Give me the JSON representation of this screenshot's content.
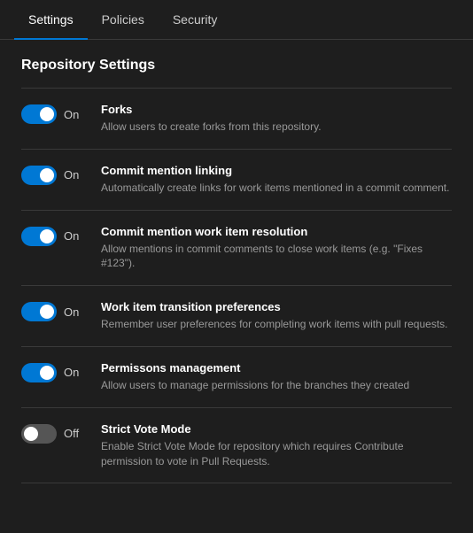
{
  "nav": {
    "tabs": [
      {
        "id": "settings",
        "label": "Settings",
        "active": true
      },
      {
        "id": "policies",
        "label": "Policies",
        "active": false
      },
      {
        "id": "security",
        "label": "Security",
        "active": false
      }
    ]
  },
  "section": {
    "title": "Repository Settings"
  },
  "settings": [
    {
      "id": "forks",
      "on": true,
      "toggle_label_on": "On",
      "toggle_label_off": "Off",
      "title": "Forks",
      "description": "Allow users to create forks from this repository."
    },
    {
      "id": "commit-mention-linking",
      "on": true,
      "toggle_label_on": "On",
      "toggle_label_off": "Off",
      "title": "Commit mention linking",
      "description": "Automatically create links for work items mentioned in a commit comment."
    },
    {
      "id": "commit-mention-work-item",
      "on": true,
      "toggle_label_on": "On",
      "toggle_label_off": "Off",
      "title": "Commit mention work item resolution",
      "description": "Allow mentions in commit comments to close work items (e.g. \"Fixes #123\")."
    },
    {
      "id": "work-item-transition",
      "on": true,
      "toggle_label_on": "On",
      "toggle_label_off": "Off",
      "title": "Work item transition preferences",
      "description": "Remember user preferences for completing work items with pull requests."
    },
    {
      "id": "permissions-management",
      "on": true,
      "toggle_label_on": "On",
      "toggle_label_off": "Off",
      "title": "Permissons management",
      "description": "Allow users to manage permissions for the branches they created"
    },
    {
      "id": "strict-vote-mode",
      "on": false,
      "toggle_label_on": "On",
      "toggle_label_off": "Off",
      "title": "Strict Vote Mode",
      "description": "Enable Strict Vote Mode for repository which requires Contribute permission to vote in Pull Requests."
    }
  ]
}
